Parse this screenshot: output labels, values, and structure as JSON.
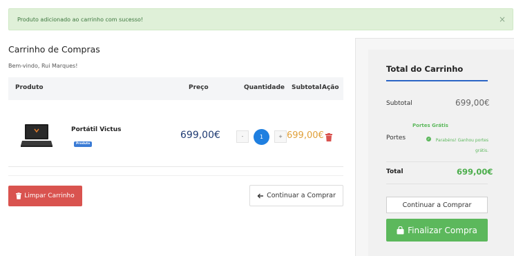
{
  "alert": {
    "message": "Produto adicionado ao carrinho com sucesso!",
    "close_symbol": "×"
  },
  "cart": {
    "title": "Carrinho de Compras",
    "welcome": "Bem-vindo, Rui Marques!",
    "columns": {
      "product": "Produto",
      "price": "Preço",
      "quantity": "Quantidade",
      "subtotal": "Subtotal",
      "action": "Ação"
    },
    "items": [
      {
        "name": "Portátil Victus",
        "badge": "Produto",
        "price": "699,00€",
        "quantity": "1",
        "minus": "-",
        "plus": "+",
        "subtotal": "699,00€",
        "icon": "trash-icon"
      }
    ],
    "clear_label": "Limpar Carrinho",
    "continue_label": "Continuar a Comprar"
  },
  "summary": {
    "title": "Total do Carrinho",
    "subtotal_label": "Subtotal",
    "subtotal_value": "699,00€",
    "shipping_label": "Portes",
    "shipping_free": "Portes Grátis",
    "shipping_msg": "Parabéns! Ganhou portes grátis.",
    "total_label": "Total",
    "total_value": "699,00€",
    "continue_label": "Continuar a Comprar",
    "checkout_label": "Finalizar Compra"
  },
  "colors": {
    "accent": "#2a64c5",
    "success": "#5cb85c",
    "danger": "#d9534f",
    "price": "#1f3b73",
    "subtotal": "#e0a03a"
  }
}
